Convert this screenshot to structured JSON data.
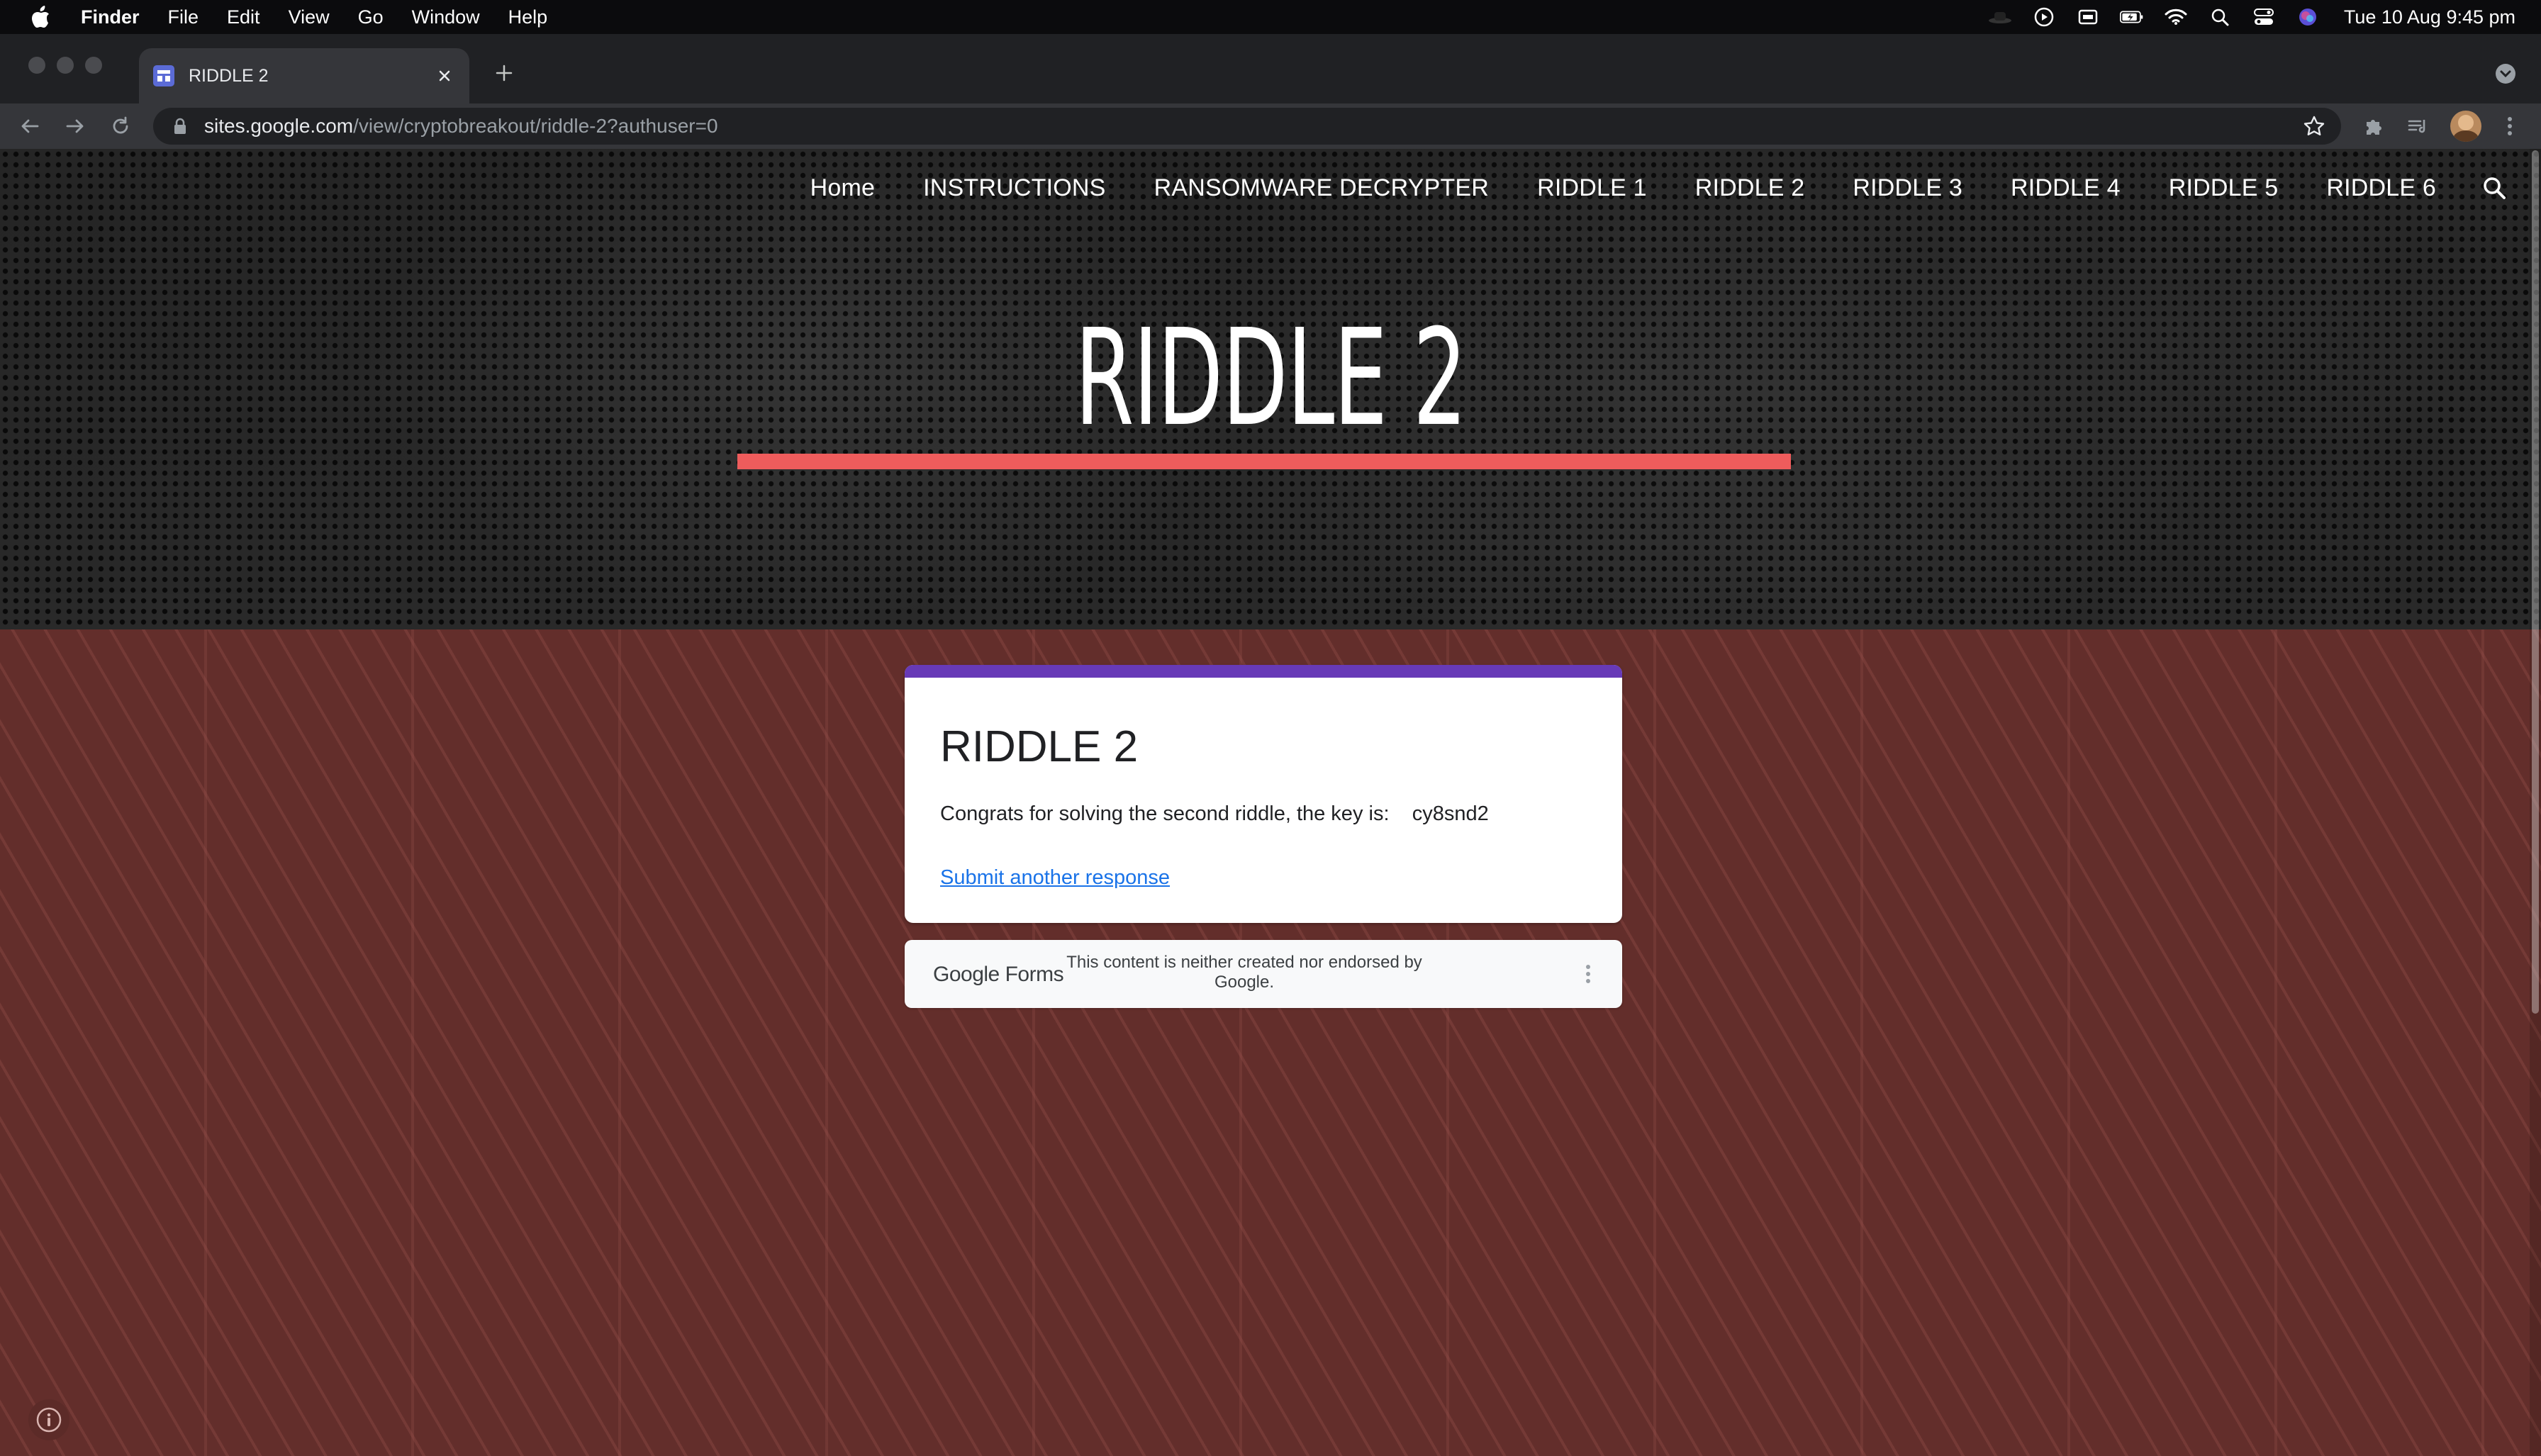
{
  "menubar": {
    "app_name": "Finder",
    "items": [
      "File",
      "Edit",
      "View",
      "Go",
      "Window",
      "Help"
    ],
    "clock": "Tue 10 Aug  9:45 pm"
  },
  "browser": {
    "tab_title": "RIDDLE 2",
    "url_host": "sites.google.com",
    "url_path": "/view/cryptobreakout/riddle-2?authuser=0"
  },
  "site": {
    "nav": [
      "Home",
      "INSTRUCTIONS",
      "RANSOMWARE DECRYPTER",
      "RIDDLE 1",
      "RIDDLE 2",
      "RIDDLE 3",
      "RIDDLE 4",
      "RIDDLE 5",
      "RIDDLE 6"
    ],
    "hero_title": "RIDDLE 2",
    "accent_color": "#ee5c5c",
    "band_color": "#632e2b"
  },
  "form": {
    "title": "RIDDLE 2",
    "message": "Congrats for solving the second riddle, the key is:    cy8snd2",
    "link": "Submit another response",
    "accent_color": "#673ab7"
  },
  "footer": {
    "brand": "Google Forms",
    "disclaimer": "This content is neither created nor endorsed by Google."
  }
}
